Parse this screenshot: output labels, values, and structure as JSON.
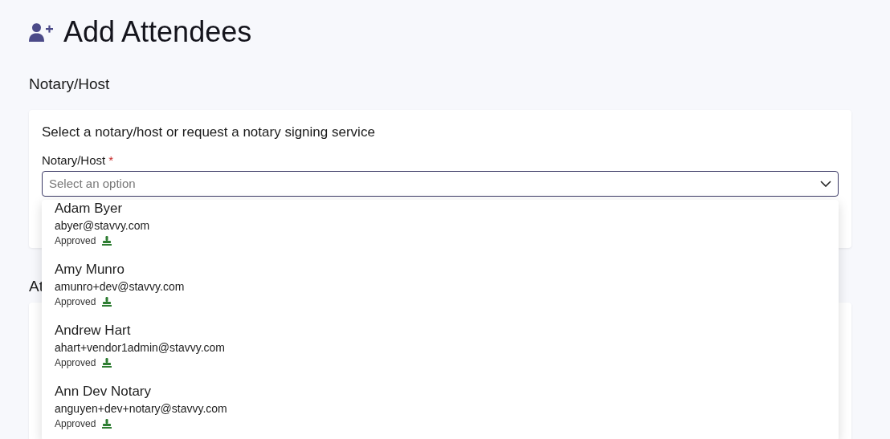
{
  "page": {
    "title": "Add Attendees"
  },
  "notary_section": {
    "heading": "Notary/Host",
    "card_text": "Select a notary/host or request a notary signing service",
    "field": {
      "label": "Notary/Host",
      "required_mark": "*",
      "placeholder": "Select an option",
      "expanded": true
    }
  },
  "options": [
    {
      "name": "Adam Byer",
      "email": "abyer@stavvy.com",
      "status": "Approved"
    },
    {
      "name": "Amy Munro",
      "email": "amunro+dev@stavvy.com",
      "status": "Approved"
    },
    {
      "name": "Andrew Hart",
      "email": "ahart+vendor1admin@stavvy.com",
      "status": "Approved"
    },
    {
      "name": "Ann Dev Notary",
      "email": "anguyen+dev+notary@stavvy.com",
      "status": "Approved"
    }
  ],
  "attendees_section": {
    "heading": "At"
  }
}
